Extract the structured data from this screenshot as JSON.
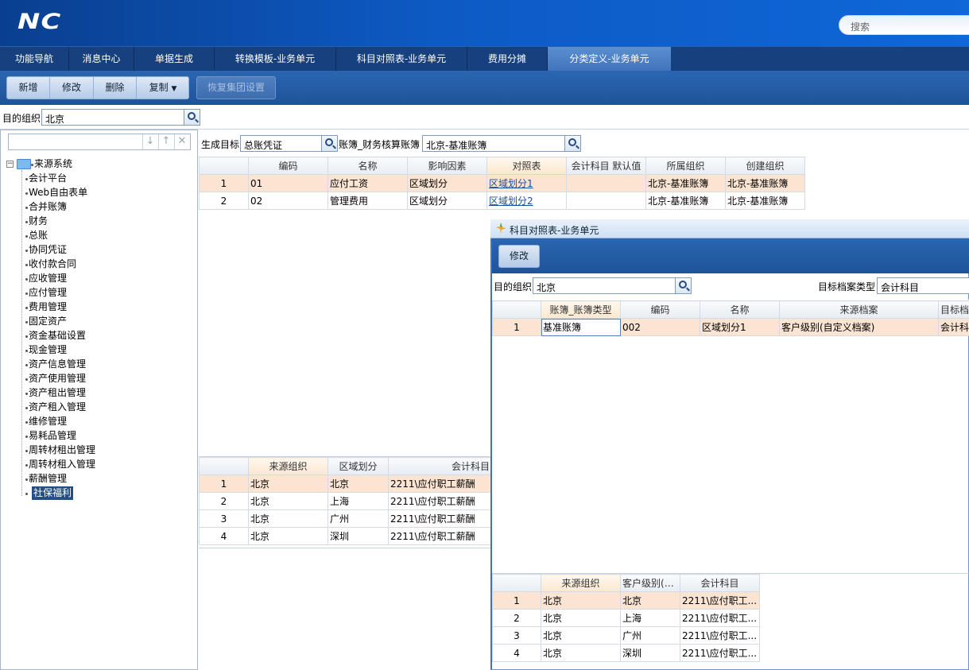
{
  "header": {
    "logo": "NC",
    "search_placeholder": "搜索"
  },
  "tabs": [
    {
      "label": "功能导航"
    },
    {
      "label": "消息中心"
    },
    {
      "label": "单据生成"
    },
    {
      "label": "转换模板-业务单元"
    },
    {
      "label": "科目对照表-业务单元"
    },
    {
      "label": "费用分摊"
    },
    {
      "label": "分类定义-业务单元"
    }
  ],
  "toolbar": {
    "add": "新增",
    "edit": "修改",
    "delete": "删除",
    "copy": "复制",
    "restore": "恢复集团设置"
  },
  "org": {
    "label": "目的组织",
    "value": "北京"
  },
  "filter": {
    "target_label": "生成目标",
    "target_value": "总账凭证",
    "book_label": "账簿_财务核算账簿",
    "book_value": "北京-基准账簿"
  },
  "tree": {
    "root": "来源系统",
    "items": [
      "会计平台",
      "Web自由表单",
      "合并账簿",
      "财务",
      "总账",
      "协同凭证",
      "收付款合同",
      "应收管理",
      "应付管理",
      "费用管理",
      "固定资产",
      "资金基础设置",
      "现金管理",
      "资产信息管理",
      "资产使用管理",
      "资产租出管理",
      "资产租入管理",
      "维修管理",
      "易耗品管理",
      "周转材租出管理",
      "周转材租入管理",
      "薪酬管理",
      "社保福利"
    ]
  },
  "main_grid": {
    "headers": [
      "编码",
      "名称",
      "影响因素",
      "对照表",
      "会计科目 默认值",
      "所属组织",
      "创建组织"
    ],
    "rows": [
      {
        "n": "1",
        "code": "01",
        "name": "应付工资",
        "factor": "区域划分",
        "table": "区域划分1",
        "default": "",
        "org": "北京-基准账簿",
        "create": "北京-基准账簿"
      },
      {
        "n": "2",
        "code": "02",
        "name": "管理费用",
        "factor": "区域划分",
        "table": "区域划分2",
        "default": "",
        "org": "北京-基准账簿",
        "create": "北京-基准账簿"
      }
    ]
  },
  "detail_grid": {
    "headers": [
      "来源组织",
      "区域划分",
      "会计科目"
    ],
    "rows": [
      {
        "n": "1",
        "org": "北京",
        "region": "北京",
        "subject": "2211\\应付职工薪酬"
      },
      {
        "n": "2",
        "org": "北京",
        "region": "上海",
        "subject": "2211\\应付职工薪酬"
      },
      {
        "n": "3",
        "org": "北京",
        "region": "广州",
        "subject": "2211\\应付职工薪酬"
      },
      {
        "n": "4",
        "org": "北京",
        "region": "深圳",
        "subject": "2211\\应付职工薪酬"
      }
    ]
  },
  "popup": {
    "title": "科目对照表-业务单元",
    "edit": "修改",
    "org_label": "目的组织",
    "org_value": "北京",
    "type_label": "目标档案类型",
    "type_value": "会计科目",
    "grid": {
      "headers": [
        "账簿_账簿类型",
        "编码",
        "名称",
        "来源档案",
        "目标档"
      ],
      "rows": [
        {
          "n": "1",
          "type": "基准账簿",
          "code": "002",
          "name": "区域划分1",
          "source": "客户级别(自定义档案)",
          "target": "会计科"
        }
      ]
    },
    "detail": {
      "headers": [
        "来源组织",
        "客户级别(自...",
        "会计科目"
      ],
      "rows": [
        {
          "n": "1",
          "org": "北京",
          "level": "北京",
          "subject": "2211\\应付职工..."
        },
        {
          "n": "2",
          "org": "北京",
          "level": "上海",
          "subject": "2211\\应付职工..."
        },
        {
          "n": "3",
          "org": "北京",
          "level": "广州",
          "subject": "2211\\应付职工..."
        },
        {
          "n": "4",
          "org": "北京",
          "level": "深圳",
          "subject": "2211\\应付职工..."
        }
      ]
    }
  }
}
